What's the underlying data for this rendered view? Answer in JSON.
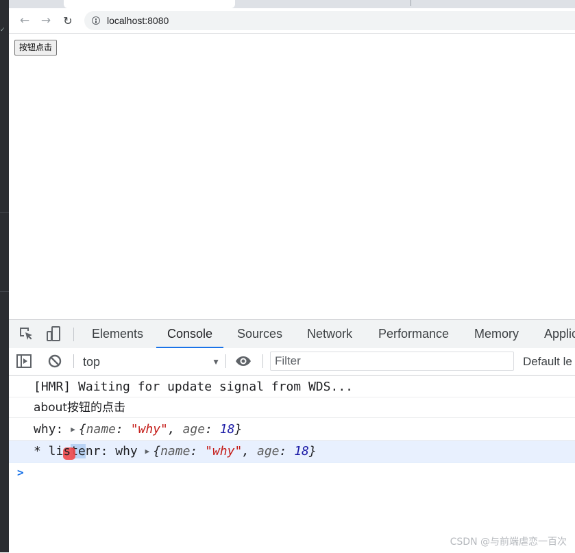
{
  "browser": {
    "url": "localhost:8080"
  },
  "page": {
    "button_label": "按钮点击"
  },
  "devtools": {
    "tabs": [
      "Elements",
      "Console",
      "Sources",
      "Network",
      "Performance",
      "Memory",
      "Applic"
    ],
    "active_tab": "Console",
    "context": "top",
    "filter_placeholder": "Filter",
    "levels_label": "Default le",
    "console": {
      "line1": "[HMR] Waiting for update signal from WDS...",
      "line2": "about按钮的点击",
      "line3_prefix": "why: ",
      "line4_prefix_a": "* li",
      "line4_prefix_b": "s",
      "line4_prefix_c": "te",
      "line4_prefix_d": "nr: why ",
      "obj_open": "{",
      "obj_name_key": "name",
      "obj_colon_space": ": ",
      "obj_name_val": "\"why\"",
      "obj_sep": ", ",
      "obj_age_key": "age",
      "obj_age_val": "18",
      "obj_close": "}",
      "prompt": ">"
    }
  },
  "watermark": "CSDN @与前端虐恋一百次"
}
